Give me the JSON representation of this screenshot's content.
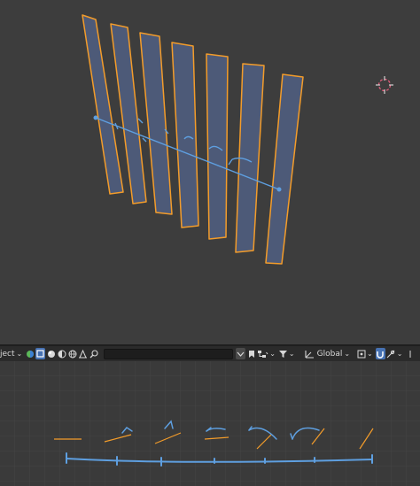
{
  "header": {
    "mode_label": "ject",
    "orientation_label": "Global",
    "search_value": ""
  },
  "icons": {
    "mode_dropdown": "chevron-down-icon",
    "render_toggle": "render-icon",
    "mesh_toggle": "mesh-icon",
    "material_toggle": "material-icon",
    "shading": "shading-icon",
    "world": "world-icon",
    "object_filter": "object-icon",
    "search": "search-icon",
    "bookmark": "bookmark-icon",
    "hierarchy": "hierarchy-icon",
    "filter": "filter-icon",
    "transform": "transform-icon",
    "pivot": "pivot-icon",
    "snap": "snap-icon",
    "proportional": "proportional-icon"
  },
  "colors": {
    "viewport_bg": "#3d3d3d",
    "panel_bg": "#3a3a3a",
    "header_bg": "#2b2b2b",
    "selection_outline": "#f39c2a",
    "plane_fill": "#4d5a78",
    "curve": "#5e9fe0",
    "active_toggle": "#4772b3",
    "cursor": "#e05c7a"
  }
}
